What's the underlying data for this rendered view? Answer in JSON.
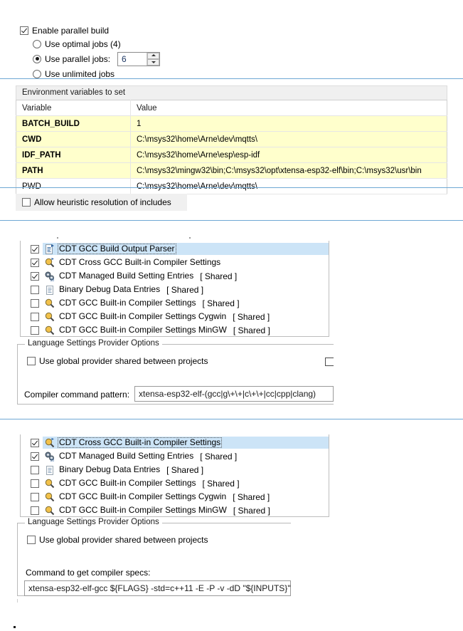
{
  "parallel_build": {
    "enable_label": "Enable parallel build",
    "enable_checked": true,
    "options": [
      {
        "label": "Use optimal jobs (4)",
        "selected": false
      },
      {
        "label": "Use parallel jobs:",
        "selected": true
      },
      {
        "label": "Use unlimited jobs",
        "selected": false
      }
    ],
    "jobs_value": "6",
    "spinner_up_icon": "spinner-up-arrow-icon",
    "spinner_down_icon": "spinner-down-arrow-icon"
  },
  "env_group": {
    "caption": "Environment variables to set",
    "columns": [
      "Variable",
      "Value"
    ],
    "rows": [
      {
        "variable": "BATCH_BUILD",
        "value": "1",
        "highlight": true,
        "bold": true
      },
      {
        "variable": "CWD",
        "value": "C:\\msys32\\home\\Arne\\dev\\mqtts\\",
        "highlight": true,
        "bold": true
      },
      {
        "variable": "IDF_PATH",
        "value": "C:\\msys32\\home\\Arne\\esp\\esp-idf",
        "highlight": true,
        "bold": true
      },
      {
        "variable": "PATH",
        "value": "C:\\msys32\\mingw32\\bin;C:\\msys32\\opt\\xtensa-esp32-elf\\bin;C:\\msys32\\usr\\bin",
        "highlight": true,
        "bold": true
      },
      {
        "variable": "PWD",
        "value": "C:\\msys32\\home\\Arne\\dev\\mqtts\\",
        "highlight": false,
        "bold": false
      }
    ]
  },
  "heuristic": {
    "label": "Allow heuristic resolution of includes",
    "checked": false
  },
  "section_one": {
    "providers": [
      {
        "label": "CDT GCC Build Output Parser",
        "shared": "",
        "checked": true,
        "selected": true,
        "icon": "build-output-parser-icon"
      },
      {
        "label": "CDT Cross GCC Built-in Compiler Settings",
        "shared": "",
        "checked": true,
        "selected": false,
        "icon": "cross-gcc-magnifier-icon"
      },
      {
        "label": "CDT Managed Build Setting Entries",
        "shared": "[ Shared ]",
        "checked": true,
        "selected": false,
        "icon": "managed-build-gears-icon"
      },
      {
        "label": "Binary Debug Data Entries",
        "shared": "[ Shared ]",
        "checked": false,
        "selected": false,
        "icon": "binary-debug-document-icon"
      },
      {
        "label": "CDT GCC Built-in Compiler Settings",
        "shared": "[ Shared ]",
        "checked": false,
        "selected": false,
        "icon": "gcc-builtin-magnifier-icon"
      },
      {
        "label": "CDT GCC Built-in Compiler Settings Cygwin",
        "shared": "[ Shared ]",
        "checked": false,
        "selected": false,
        "icon": "gcc-builtin-magnifier-icon"
      },
      {
        "label": "CDT GCC Built-in Compiler Settings MinGW",
        "shared": "[ Shared ]",
        "checked": false,
        "selected": false,
        "icon": "gcc-builtin-magnifier-icon"
      }
    ],
    "options_title": "Language Settings Provider Options",
    "global_provider_label": "Use global provider shared between projects",
    "global_provider_checked": false,
    "field_label": "Compiler command pattern:",
    "field_value": "xtensa-esp32-elf-(gcc|g\\+\\+|c\\+\\+|cc|cpp|clang)"
  },
  "section_two": {
    "providers": [
      {
        "label": "CDT Cross GCC Built-in Compiler Settings",
        "shared": "",
        "checked": true,
        "selected": true,
        "icon": "cross-gcc-magnifier-icon"
      },
      {
        "label": "CDT Managed Build Setting Entries",
        "shared": "[ Shared ]",
        "checked": true,
        "selected": false,
        "icon": "managed-build-gears-icon"
      },
      {
        "label": "Binary Debug Data Entries",
        "shared": "[ Shared ]",
        "checked": false,
        "selected": false,
        "icon": "binary-debug-document-icon"
      },
      {
        "label": "CDT GCC Built-in Compiler Settings",
        "shared": "[ Shared ]",
        "checked": false,
        "selected": false,
        "icon": "gcc-builtin-magnifier-icon"
      },
      {
        "label": "CDT GCC Built-in Compiler Settings Cygwin",
        "shared": "[ Shared ]",
        "checked": false,
        "selected": false,
        "icon": "gcc-builtin-magnifier-icon"
      },
      {
        "label": "CDT GCC Built-in Compiler Settings MinGW",
        "shared": "[ Shared ]",
        "checked": false,
        "selected": false,
        "icon": "gcc-builtin-magnifier-icon"
      }
    ],
    "options_title": "Language Settings Provider Options",
    "global_provider_label": "Use global provider shared between projects",
    "global_provider_checked": false,
    "field_label": "Command to get compiler specs:",
    "field_value": "xtensa-esp32-elf-gcc ${FLAGS} -std=c++11 -E -P -v -dD \"${INPUTS}\""
  },
  "colors": {
    "separator": "#6fa8d4",
    "row_highlight": "#ffffcc",
    "selection": "#cce4f7",
    "group_header": "#f0f0f0"
  }
}
